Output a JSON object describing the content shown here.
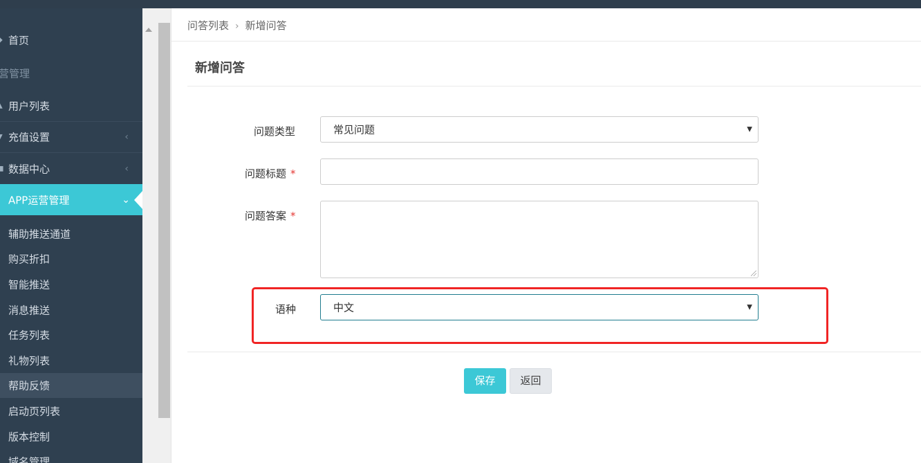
{
  "sidebar": {
    "home": "首页",
    "section_ops": "营管理",
    "user_list": "用户列表",
    "recharge_settings": "充值设置",
    "data_center": "数据中心",
    "app_ops": "APP运营管理",
    "submenu": [
      "辅助推送通道",
      "购买折扣",
      "智能推送",
      "消息推送",
      "任务列表",
      "礼物列表",
      "帮助反馈",
      "启动页列表",
      "版本控制",
      "域名管理"
    ],
    "selected_index": 6,
    "accent_color": "#3cc8d6"
  },
  "breadcrumb": {
    "parent": "问答列表",
    "separator": "›",
    "current": "新增问答"
  },
  "page_title": "新增问答",
  "form": {
    "question_type_label": "问题类型",
    "question_type_value": "常见问题",
    "question_title_label": "问题标题",
    "question_title_value": "",
    "answer_label": "问题答案",
    "answer_value": "",
    "required_mark": "*",
    "language_label": "语种",
    "language_value": "中文"
  },
  "buttons": {
    "save": "保存",
    "back": "返回"
  }
}
